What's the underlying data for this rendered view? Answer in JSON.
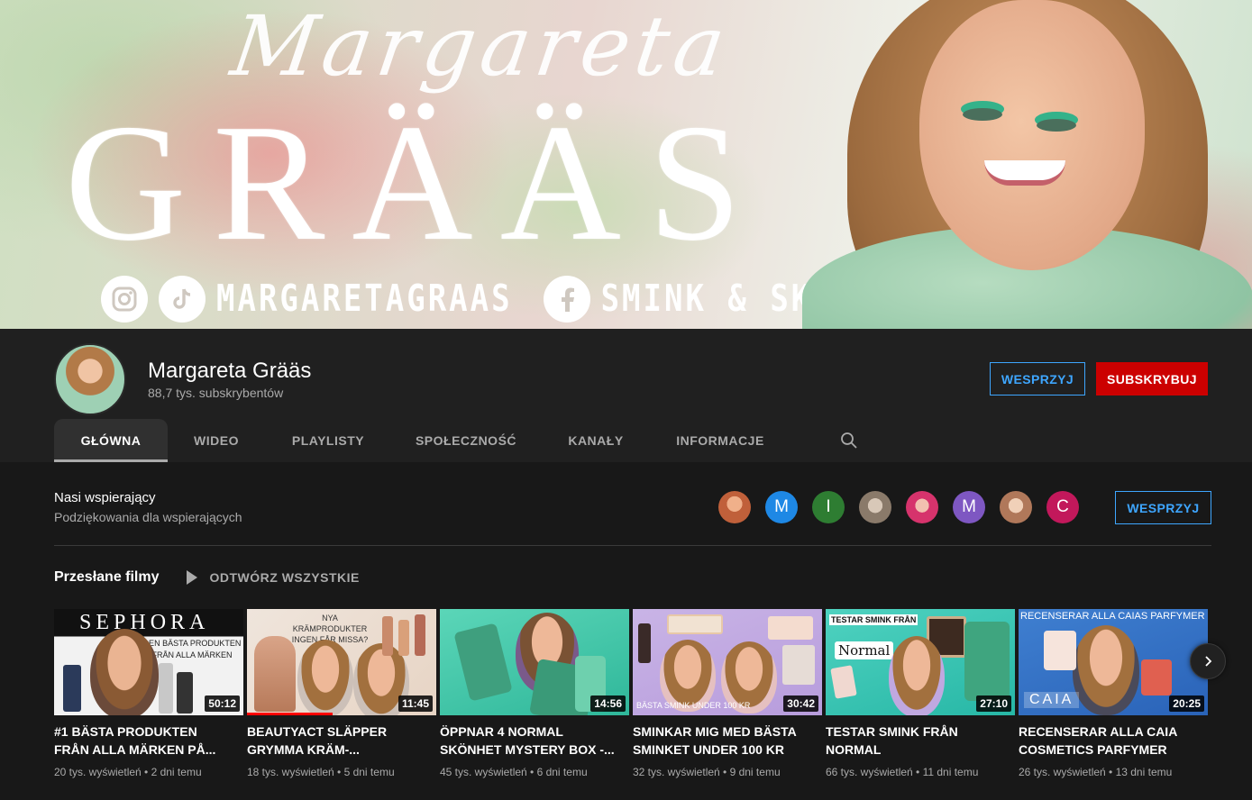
{
  "banner": {
    "script_text": "Margareta",
    "name_text": "GRÄÄS",
    "social_handle": "MARGARETAGRAAS",
    "social_page": "SMINK & SKÖNHET",
    "icons": [
      "instagram-icon",
      "tiktok-icon",
      "facebook-icon"
    ]
  },
  "channel": {
    "title": "Margareta Grääs",
    "subscribers": "88,7 tys. subskrybentów",
    "support_label": "WESPRZYJ",
    "subscribe_label": "SUBSKRYBUJ"
  },
  "tabs": [
    {
      "label": "GŁÓWNA",
      "active": true
    },
    {
      "label": "WIDEO",
      "active": false
    },
    {
      "label": "PLAYLISTY",
      "active": false
    },
    {
      "label": "SPOŁECZNOŚĆ",
      "active": false
    },
    {
      "label": "KANAŁY",
      "active": false
    },
    {
      "label": "INFORMACJE",
      "active": false
    }
  ],
  "supporters": {
    "title": "Nasi wspierający",
    "subtitle": "Podziękowania dla wspierających",
    "support_label": "WESPRZYJ",
    "avatars": [
      {
        "letter": "",
        "color": "#c0603a"
      },
      {
        "letter": "M",
        "color": "#1e88e5"
      },
      {
        "letter": "I",
        "color": "#2e7d32"
      },
      {
        "letter": "",
        "color": "#8a7a6a"
      },
      {
        "letter": "",
        "color": "#d6336c"
      },
      {
        "letter": "M",
        "color": "#7e57c2"
      },
      {
        "letter": "",
        "color": "#b0785a"
      },
      {
        "letter": "C",
        "color": "#c2185b"
      }
    ]
  },
  "uploads": {
    "title": "Przesłane filmy",
    "play_all": "ODTWÓRZ WSZYSTKIE",
    "videos": [
      {
        "title": "#1 BÄSTA PRODUKTEN FRÅN ALLA MÄRKEN PÅ...",
        "views": "20 tys. wyświetleń",
        "age": "2 dni temu",
        "duration": "50:12",
        "thumb_text": "SEPHORA",
        "thumb_sub": "DEN BÄSTA PRODUKTEN FRÅN ALLA MÄRKEN",
        "progress": 0
      },
      {
        "title": "BEAUTYACT SLÄPPER GRYMMA KRÄM-...",
        "views": "18 tys. wyświetleń",
        "age": "5 dni temu",
        "duration": "11:45",
        "thumb_text": "NYA KRÄMPRODUKTER INGEN FÅR MISSA?",
        "thumb_sub": "",
        "progress": 0.45
      },
      {
        "title": "ÖPPNAR 4 NORMAL SKÖNHET MYSTERY BOX -...",
        "views": "45 tys. wyświetleń",
        "age": "6 dni temu",
        "duration": "14:56",
        "thumb_text": "",
        "thumb_sub": "",
        "progress": 0
      },
      {
        "title": "SMINKAR MIG MED BÄSTA SMINKET UNDER 100 KR",
        "views": "32 tys. wyświetleń",
        "age": "9 dni temu",
        "duration": "30:42",
        "thumb_text": "BÄSTA SMINK UNDER 100 KR",
        "thumb_sub": "",
        "progress": 0
      },
      {
        "title": "TESTAR SMINK FRÅN NORMAL",
        "views": "66 tys. wyświetleń",
        "age": "11 dni temu",
        "duration": "27:10",
        "thumb_text": "TESTAR SMINK FRÅN",
        "thumb_sub": "Normal",
        "progress": 0
      },
      {
        "title": "RECENSERAR ALLA CAIA COSMETICS PARFYMER",
        "views": "26 tys. wyświetleń",
        "age": "13 dni temu",
        "duration": "20:25",
        "thumb_text": "RECENSERAR ALLA CAIAS PARFYMER",
        "thumb_sub": "CAIA",
        "progress": 0
      }
    ]
  },
  "icons": {
    "search": "search-icon",
    "next": "chevron-right-icon",
    "play_all": "play-icon"
  },
  "colors": {
    "accent_blue": "#3ea6ff",
    "subscribe_red": "#cc0000",
    "background": "#181818",
    "header_bg": "#202020"
  }
}
